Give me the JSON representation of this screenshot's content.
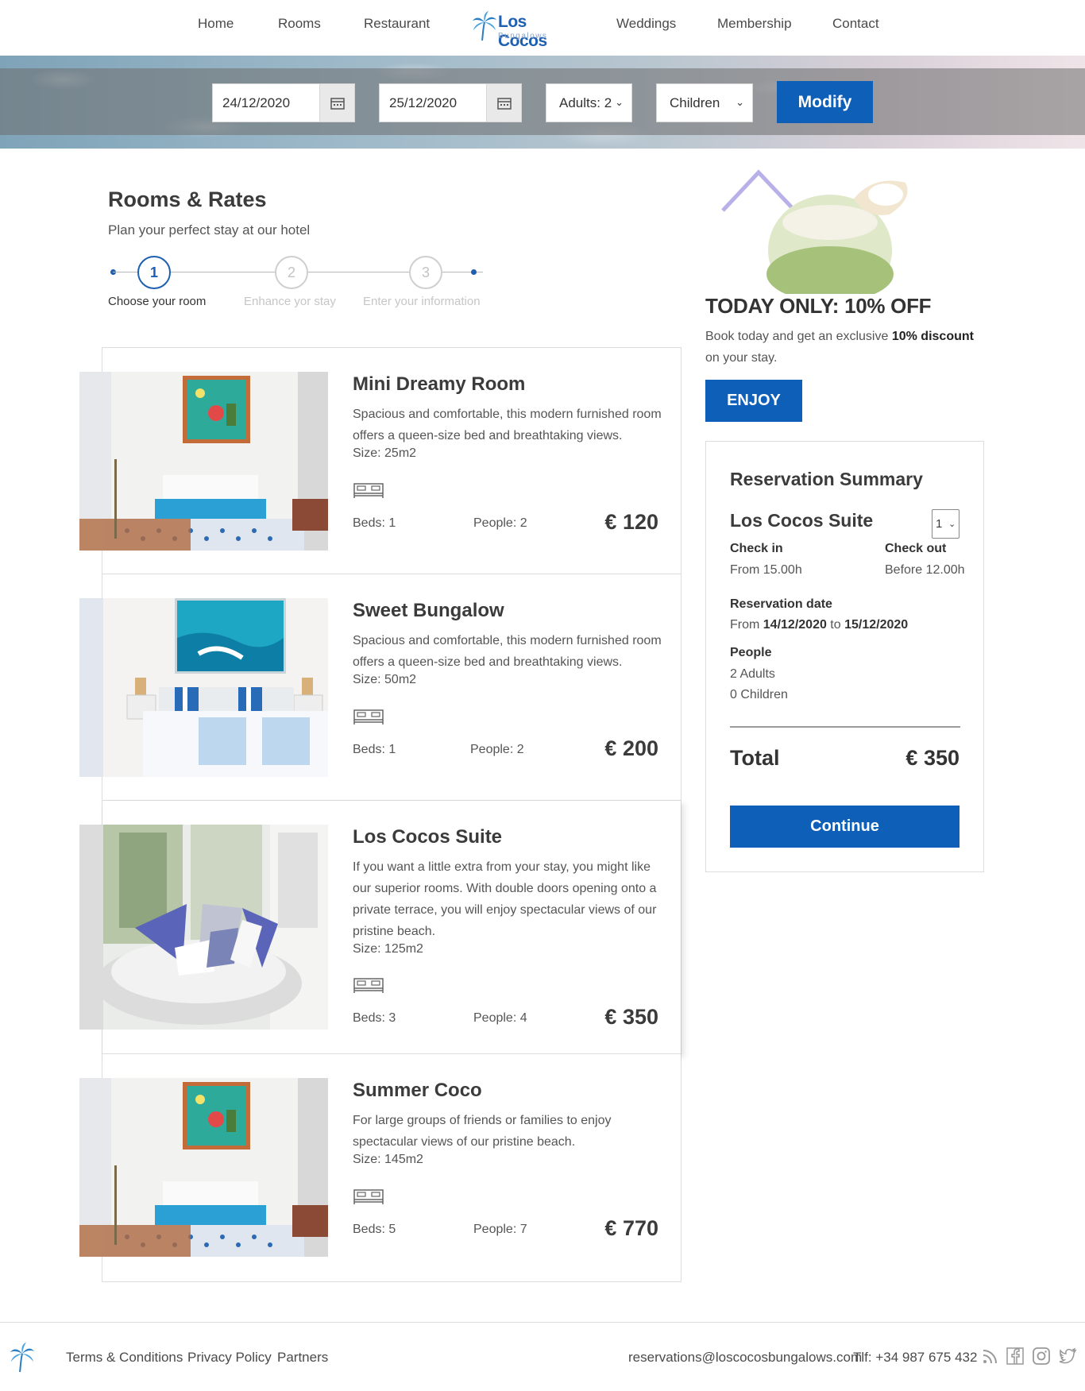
{
  "nav": {
    "items": [
      "Home",
      "Rooms",
      "Restaurant",
      "Weddings",
      "Membership",
      "Contact"
    ],
    "logo_brand": "Los Cocos",
    "logo_sub": "Bungalows"
  },
  "search": {
    "checkin": "24/12/2020",
    "checkout": "25/12/2020",
    "adults": "Adults: 2",
    "children": "Children",
    "modify_label": "Modify"
  },
  "heading": {
    "title": "Rooms & Rates",
    "subtitle": "Plan your perfect stay at our hotel"
  },
  "stepper": {
    "steps": [
      {
        "number": "1",
        "label": "Choose your room",
        "active": true
      },
      {
        "number": "2",
        "label": "Enhance yor stay",
        "active": false
      },
      {
        "number": "3",
        "label": "Enter your information",
        "active": false
      }
    ]
  },
  "rooms": [
    {
      "name": "Mini Dreamy Room",
      "description": "Spacious and comfortable, this modern furnished room offers a queen-size bed and breathtaking views.",
      "size": "Size: 25m2",
      "beds": "Beds: 1",
      "people": "People: 2",
      "price": "€ 120"
    },
    {
      "name": "Sweet Bungalow",
      "description": "Spacious and comfortable, this modern furnished room offers a queen-size bed and breathtaking views.",
      "size": "Size: 50m2",
      "beds": "Beds: 1",
      "people": "People: 2",
      "price": "€ 200"
    },
    {
      "name": "Los Cocos Suite",
      "description": "If you want a little extra from your stay, you might like our superior rooms. With double doors opening onto a private terrace, you will enjoy spectacular views of our pristine beach.",
      "size": "Size: 125m2",
      "beds": "Beds: 3",
      "people": "People: 4",
      "price": "€ 350"
    },
    {
      "name": "Summer Coco",
      "description": "For large groups of friends or families to enjoy spectacular views of our pristine beach.",
      "size": "Size: 145m2",
      "beds": "Beds: 5",
      "people": "People: 7",
      "price": "€ 770"
    }
  ],
  "promo": {
    "title": "TODAY ONLY: 10% OFF",
    "text_before": "Book today and get an exclusive ",
    "text_bold": "10% discount",
    "text_after": " on your stay.",
    "button": "ENJOY"
  },
  "summary": {
    "title": "Reservation Summary",
    "room": "Los Cocos Suite",
    "quantity": "1",
    "checkin_label": "Check in",
    "checkin_value": "From 15.00h",
    "checkout_label": "Check out",
    "checkout_value": "Before 12.00h",
    "date_label": "Reservation date",
    "date_from_word": "From ",
    "date_from": "14/12/2020",
    "date_to_word": " to ",
    "date_to": "15/12/2020",
    "people_label": "People",
    "adults": "2 Adults",
    "children": "0 Children",
    "total_label": "Total",
    "total_value": "€ 350",
    "continue_label": "Continue"
  },
  "footer": {
    "links": [
      "Terms & Conditions",
      "Privacy Policy",
      "Partners"
    ],
    "email": "reservations@loscocosbungalows.com",
    "phone": "Tlf: +34 987 675 432",
    "social_icons": [
      "rss-icon",
      "facebook-icon",
      "instagram-icon",
      "twitter-icon"
    ]
  },
  "colors": {
    "accent": "#0d5fb8",
    "brand": "#1d5fb0"
  }
}
